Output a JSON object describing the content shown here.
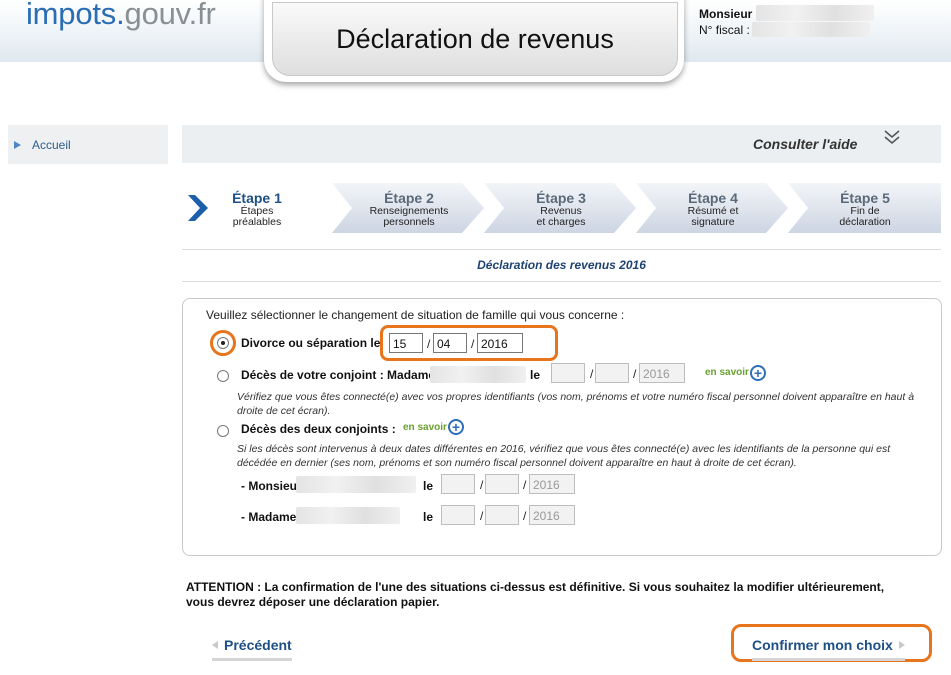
{
  "header": {
    "logo_part1": "impots.",
    "logo_part2": "gouv.fr",
    "title": "Déclaration de revenus",
    "user_title": "Monsieur",
    "fiscal_label": "N° fiscal :"
  },
  "nav": {
    "home": "Accueil"
  },
  "help": {
    "label": "Consulter l'aide",
    "icon": "double-chevron-down-icon"
  },
  "steps": [
    {
      "num": "Étape 1",
      "line1": "Étapes",
      "line2": "préalables"
    },
    {
      "num": "Étape 2",
      "line1": "Renseignements",
      "line2": "personnels"
    },
    {
      "num": "Étape 3",
      "line1": "Revenus",
      "line2": "et charges"
    },
    {
      "num": "Étape 4",
      "line1": "Résumé et",
      "line2": "signature"
    },
    {
      "num": "Étape 5",
      "line1": "Fin de",
      "line2": "déclaration"
    }
  ],
  "declaration_title": "Déclaration des revenus 2016",
  "form": {
    "intro": "Veuillez sélectionner le changement de situation de famille qui vous concerne :",
    "option1": {
      "label": "Divorce ou séparation le",
      "day": "15",
      "month": "04",
      "year": "2016"
    },
    "option2": {
      "label": "Décès de votre conjoint : Madame",
      "le": "le",
      "year_placeholder": "2016",
      "more": "en savoir",
      "note": "Vérifiez que vous êtes connecté(e) avec vos propres identifiants (vos nom, prénoms et votre numéro fiscal personnel doivent apparaître en haut à droite de cet écran)."
    },
    "option3": {
      "label": "Décès des deux conjoints :",
      "more": "en savoir",
      "note": "Si les décès sont intervenus à deux dates différentes en 2016, vérifiez que vous êtes connecté(e) avec les identifiants de la personne qui est décédée en dernier (ses nom, prénoms et son numéro fiscal personnel doivent apparaître en haut à droite de cet écran).",
      "monsieur": "- Monsieu",
      "madame": "- Madame",
      "le": "le",
      "year_placeholder": "2016"
    },
    "slash": "/"
  },
  "warning": "ATTENTION : La confirmation de l'une des situations ci-dessus est définitive. Si vous souhaitez la modifier ultérieurement, vous devrez déposer une déclaration papier.",
  "buttons": {
    "previous": "Précédent",
    "confirm": "Confirmer mon choix"
  },
  "colors": {
    "highlight": "#e8741c",
    "primary_blue": "#1e4f86",
    "accent_green": "#6aa030"
  }
}
